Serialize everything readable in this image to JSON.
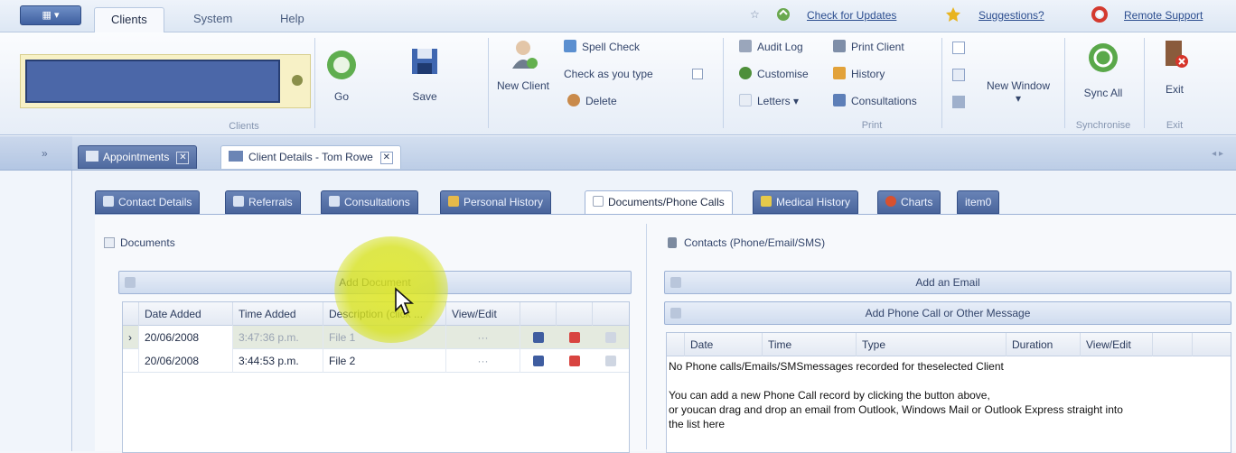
{
  "ribbon_tabs": [
    {
      "label": "Clients",
      "active": true
    },
    {
      "label": "System",
      "active": false
    },
    {
      "label": "Help",
      "active": false
    }
  ],
  "top_links": {
    "check_updates": "Check for Updates",
    "suggestions": "Suggestions?",
    "remote_support": "Remote Support"
  },
  "clients_group": {
    "search_value": "",
    "go_label": "Go",
    "save_label": "Save",
    "new_client_label": "New Client",
    "spell_check": "Spell Check",
    "check_as_you_type": "Check as you type",
    "delete": "Delete",
    "group_label": "Clients"
  },
  "print_group": {
    "audit_log": "Audit Log",
    "customise": "Customise",
    "letters": "Letters",
    "print_client": "Print Client",
    "history": "History",
    "consultations": "Consultations",
    "group_label": "Print"
  },
  "window_group": {
    "new_window": "New Window"
  },
  "sync_group": {
    "sync_all": "Sync All",
    "group_label": "Synchronise"
  },
  "exit_group": {
    "exit": "Exit",
    "group_label": "Exit"
  },
  "doc_tabs": [
    {
      "label": "Appointments",
      "style": "dark"
    },
    {
      "label": "Client Details - Tom Rowe",
      "style": "light"
    }
  ],
  "inner_tabs": [
    {
      "label": "Contact Details",
      "active": false
    },
    {
      "label": "Referrals",
      "active": false
    },
    {
      "label": "Consultations",
      "active": false
    },
    {
      "label": "Personal History",
      "active": false
    },
    {
      "label": "Documents/Phone Calls",
      "active": true
    },
    {
      "label": "Medical History",
      "active": false
    },
    {
      "label": "Charts",
      "active": false
    },
    {
      "label": "item0",
      "active": false
    }
  ],
  "documents": {
    "title": "Documents",
    "add_button": "Add Document",
    "columns": [
      "Date Added",
      "Time Added",
      "Description (click ...",
      "View/Edit"
    ],
    "rows": [
      {
        "date": "20/06/2008",
        "time": "3:47:36 p.m.",
        "description": "File 1",
        "view": "···",
        "selected": true
      },
      {
        "date": "20/06/2008",
        "time": "3:44:53 p.m.",
        "description": "File 2",
        "view": "···",
        "selected": false
      }
    ]
  },
  "contacts": {
    "title": "Contacts (Phone/Email/SMS)",
    "add_email": "Add an Email",
    "add_phone": "Add Phone Call or Other Message",
    "columns": [
      "Date",
      "Time",
      "Type",
      "Duration",
      "View/Edit"
    ],
    "empty_message": "No Phone calls/Emails/SMSmessages recorded for theselected Client",
    "hint_line1": "You can add a new Phone Call record by clicking the button above,",
    "hint_line2": "or youcan drag and drop an email from Outlook, Windows Mail or Outlook Express straight into",
    "hint_line3": "the list here"
  },
  "colors": {
    "accent": "#4b67a8",
    "highlight": "#dde61e"
  }
}
